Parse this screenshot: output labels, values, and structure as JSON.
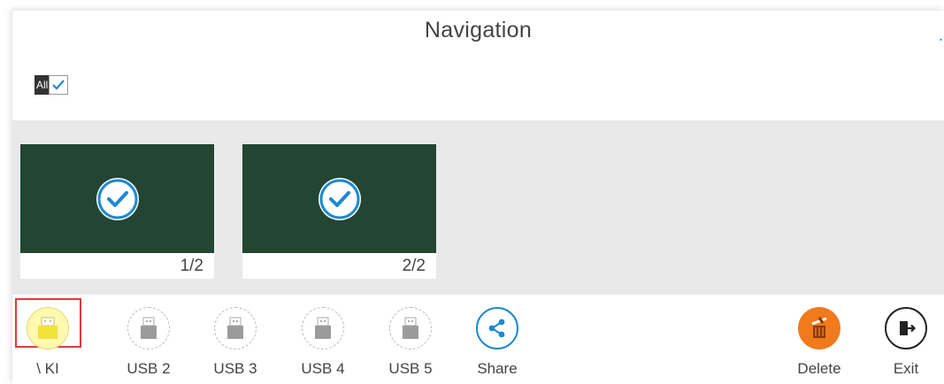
{
  "window": {
    "title": "Navigation"
  },
  "select_all": {
    "label": "All",
    "checked": true
  },
  "thumbnails": [
    {
      "caption": "1/2",
      "selected": true
    },
    {
      "caption": "2/2",
      "selected": true
    }
  ],
  "toolbar": {
    "usb_items": [
      {
        "label": "\\    KI",
        "active": true
      },
      {
        "label": "USB 2",
        "active": false
      },
      {
        "label": "USB 3",
        "active": false
      },
      {
        "label": "USB 4",
        "active": false
      },
      {
        "label": "USB 5",
        "active": false
      }
    ],
    "share_label": "Share",
    "delete_label": "Delete",
    "exit_label": "Exit"
  },
  "colors": {
    "accent": "#1d89d1",
    "thumbnail_bg": "#234632",
    "usb_active": "#f2e23a",
    "delete": "#f07a1c",
    "highlight": "#e03b3b"
  }
}
